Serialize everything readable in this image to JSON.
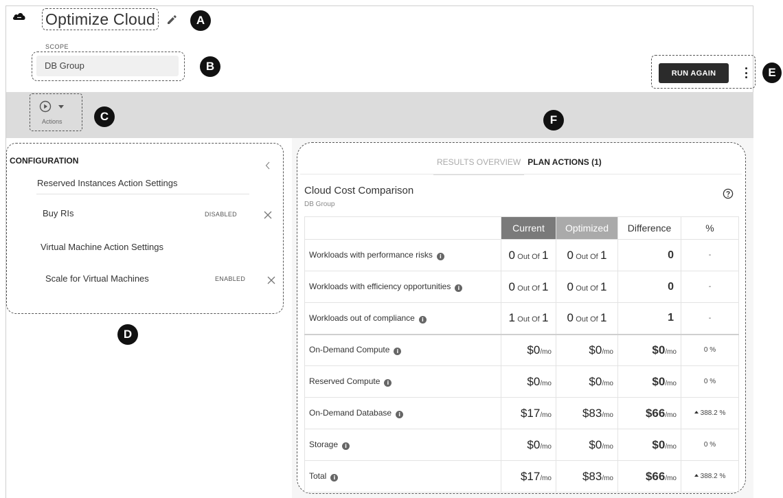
{
  "header": {
    "title": "Optimize Cloud",
    "scope_label": "SCOPE",
    "scope_value": "DB Group",
    "run_button": "RUN AGAIN"
  },
  "callouts": {
    "a": "A",
    "b": "B",
    "c": "C",
    "d": "D",
    "e": "E",
    "f": "F"
  },
  "action_bar": {
    "actions_label": "Actions"
  },
  "configuration": {
    "title": "CONFIGURATION",
    "sections": [
      {
        "heading": "Reserved Instances Action Settings",
        "item": "Buy RIs",
        "status": "DISABLED"
      },
      {
        "heading": "Virtual Machine Action Settings",
        "item": "Scale for Virtual Machines",
        "status": "ENABLED"
      }
    ]
  },
  "results": {
    "tabs": [
      {
        "label": "RESULTS OVERVIEW",
        "active": false
      },
      {
        "label": "PLAN ACTIONS (1)",
        "active": true
      }
    ],
    "title": "Cloud Cost Comparison",
    "subtitle": "DB Group",
    "info_glyph": "i",
    "columns": [
      "Current",
      "Optimized",
      "Difference",
      "%"
    ],
    "workload_rows": [
      {
        "label": "Workloads with performance risks",
        "current": "0",
        "current_total": "1",
        "optimized": "0",
        "optimized_total": "1",
        "difference": "0",
        "pct": "-"
      },
      {
        "label": "Workloads with efficiency opportunities",
        "current": "0",
        "current_total": "1",
        "optimized": "0",
        "optimized_total": "1",
        "difference": "0",
        "pct": "-"
      },
      {
        "label": "Workloads out of compliance",
        "current": "1",
        "current_total": "1",
        "optimized": "0",
        "optimized_total": "1",
        "difference": "1",
        "pct": "-"
      }
    ],
    "out_of_text": "Out Of",
    "unit": "/mo",
    "cost_rows": [
      {
        "label": "On-Demand Compute",
        "current": "$0",
        "optimized": "$0",
        "difference": "$0",
        "pct": "0 %",
        "increase": false
      },
      {
        "label": "Reserved Compute",
        "current": "$0",
        "optimized": "$0",
        "difference": "$0",
        "pct": "0 %",
        "increase": false
      },
      {
        "label": "On-Demand Database",
        "current": "$17",
        "optimized": "$83",
        "difference": "$66",
        "pct": "388.2 %",
        "increase": true
      },
      {
        "label": "Storage",
        "current": "$0",
        "optimized": "$0",
        "difference": "$0",
        "pct": "0 %",
        "increase": false
      },
      {
        "label": "Total",
        "current": "$17",
        "optimized": "$83",
        "difference": "$66",
        "pct": "388.2 %",
        "increase": true
      }
    ]
  }
}
